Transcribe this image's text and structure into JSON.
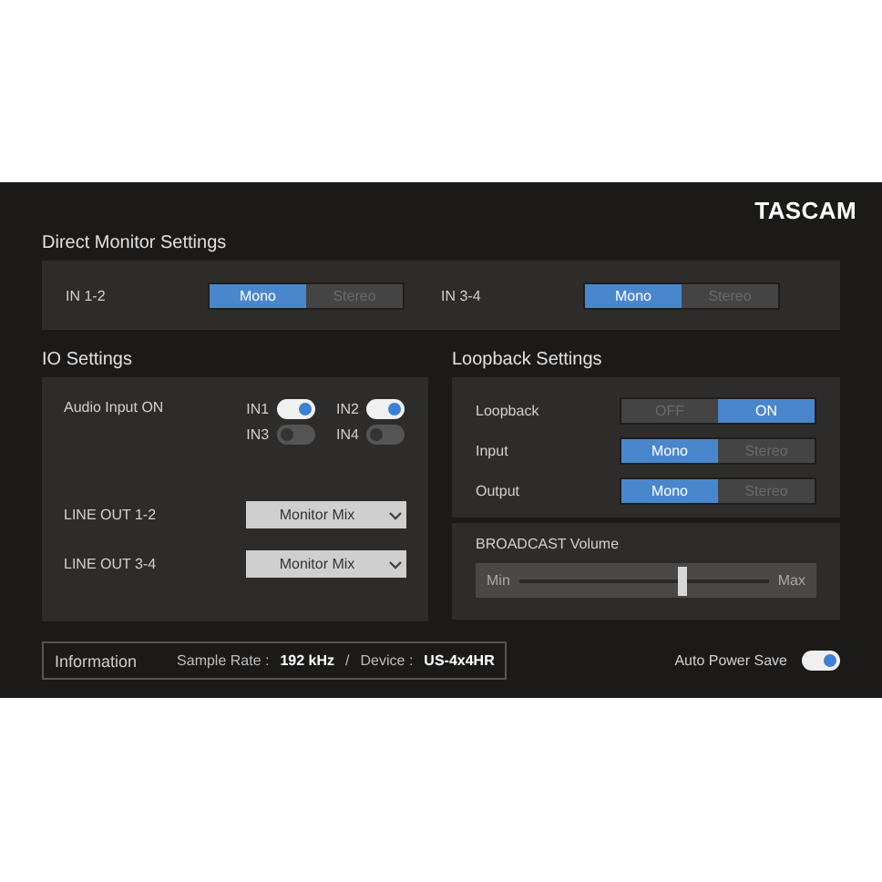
{
  "brand": "TASCAM",
  "direct_monitor": {
    "title": "Direct Monitor Settings",
    "channels": [
      {
        "label": "IN 1-2",
        "options": [
          {
            "label": "Mono",
            "selected": true
          },
          {
            "label": "Stereo",
            "selected": false
          }
        ]
      },
      {
        "label": "IN 3-4",
        "options": [
          {
            "label": "Mono",
            "selected": true
          },
          {
            "label": "Stereo",
            "selected": false
          }
        ]
      }
    ]
  },
  "io_settings": {
    "title": "IO Settings",
    "audio_input_label": "Audio Input ON",
    "inputs": [
      {
        "label": "IN1",
        "on": true
      },
      {
        "label": "IN2",
        "on": true
      },
      {
        "label": "IN3",
        "on": false
      },
      {
        "label": "IN4",
        "on": false
      }
    ],
    "line_outs": [
      {
        "label": "LINE OUT 1-2",
        "value": "Monitor Mix"
      },
      {
        "label": "LINE OUT 3-4",
        "value": "Monitor Mix"
      }
    ]
  },
  "loopback": {
    "title": "Loopback Settings",
    "rows": [
      {
        "label": "Loopback",
        "options": [
          {
            "label": "OFF",
            "selected": false
          },
          {
            "label": "ON",
            "selected": true
          }
        ]
      },
      {
        "label": "Input",
        "options": [
          {
            "label": "Mono",
            "selected": true
          },
          {
            "label": "Stereo",
            "selected": false
          }
        ]
      },
      {
        "label": "Output",
        "options": [
          {
            "label": "Mono",
            "selected": true
          },
          {
            "label": "Stereo",
            "selected": false
          }
        ]
      }
    ]
  },
  "broadcast": {
    "title": "BROADCAST Volume",
    "min_label": "Min",
    "max_label": "Max",
    "level": 0.65
  },
  "information": {
    "title": "Information",
    "sample_rate_label": "Sample Rate :",
    "sample_rate": "192 kHz",
    "separator": "/",
    "device_label": "Device :",
    "device": "US-4x4HR"
  },
  "auto_power_save": {
    "label": "Auto Power Save",
    "on": true
  }
}
